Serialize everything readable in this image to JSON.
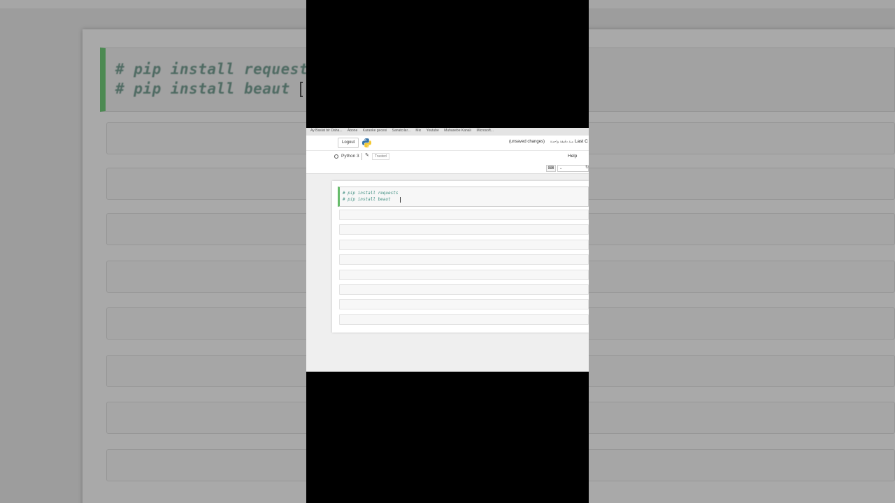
{
  "bookmarks": {
    "items": [
      "Ay Baslat bir Daha...",
      "Abone",
      "Karaoke gecesi",
      "Sanatcılar...",
      "Mix",
      "Youtube",
      "Muhasebe Kanalı",
      "Microsoft..."
    ]
  },
  "header": {
    "logout_label": "Logout",
    "logo_icon": "python-logo-icon",
    "status_text": "(unsaved changes)",
    "arabic_text": "منذ دقيقة واحدة",
    "last_checkpoint_label": "Last C"
  },
  "menubar": {
    "kernel_name": "Python 3",
    "trusted_label": "Trusted",
    "help_label": "Help"
  },
  "toolbar": {
    "keyboard_icon": "keyboard-icon",
    "select_value": "",
    "refresh_icon": "refresh-icon"
  },
  "cell": {
    "lines": [
      "# pip install requests",
      "# pip install beaut"
    ]
  },
  "colors": {
    "accent_green": "#66bb6a",
    "comment_color": "#3c8d7f"
  }
}
